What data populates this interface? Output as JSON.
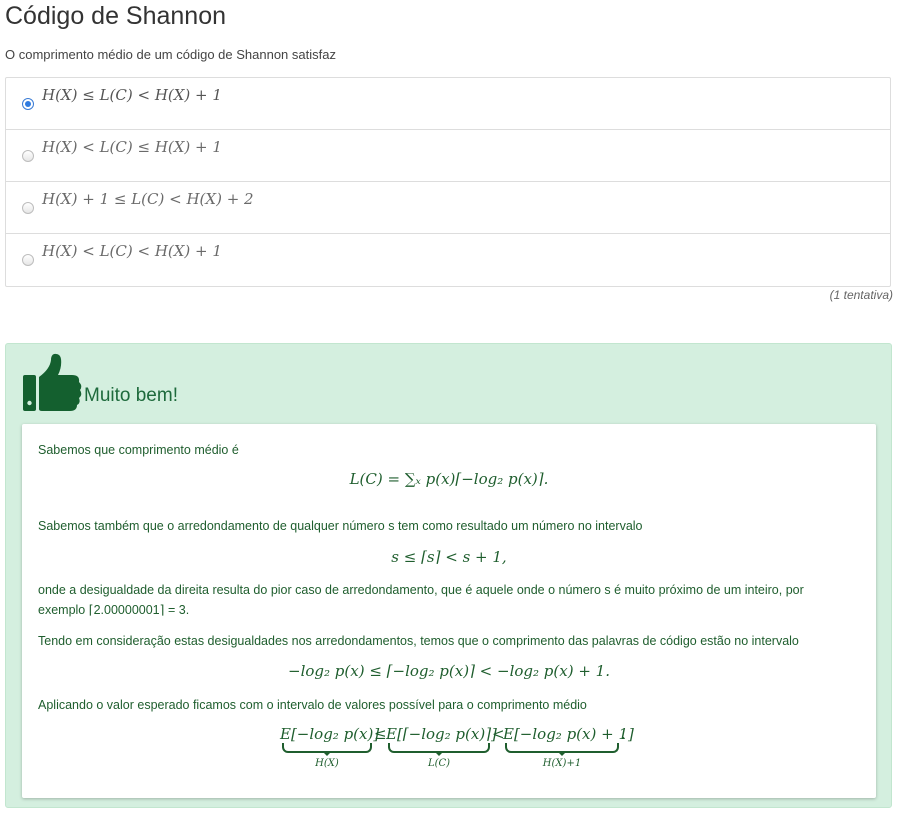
{
  "page": {
    "title": "Código de Shannon",
    "question": "O comprimento médio de um código de Shannon satisfaz"
  },
  "options": [
    {
      "label": "H(X) ≤ L(C) < H(X) + 1",
      "selected": true
    },
    {
      "label": "H(X) < L(C) ≤ H(X) + 1",
      "selected": false
    },
    {
      "label": "H(X) + 1 ≤ L(C) < H(X) + 2",
      "selected": false
    },
    {
      "label": "H(X) < L(C) < H(X) + 1",
      "selected": false
    }
  ],
  "attempts": "(1 tentativa)",
  "feedback": {
    "icon": "thumbs-up-icon",
    "title": "Muito bem!",
    "p1": "Sabemos que comprimento médio é",
    "eq1": "L(C) = ∑ₓ p(x)⌈−log₂ p(x)⌉.",
    "p2": "Sabemos também que o arredondamento de qualquer número s tem como resultado um número no intervalo",
    "eq2": "s ≤ ⌈s⌉ < s + 1,",
    "p3": "onde a desigualdade da direita resulta do pior caso de arredondamento, que é aquele onde o número s é muito próximo de um inteiro, por exemplo ⌈2.00000001⌉ = 3.",
    "p4": "Tendo em consideração estas desigualdades nos arredondamentos, temos que o comprimento das palavras de código estão no intervalo",
    "eq3": "−log₂ p(x) ≤ ⌈−log₂ p(x)⌉ < −log₂ p(x) + 1.",
    "p5": "Aplicando o valor esperado ficamos com o intervalo de valores possível para o comprimento médio",
    "eq4": {
      "term1": "E[−log₂ p(x)]",
      "term1_label": "H(X)",
      "rel1": "≤",
      "term2": "E[⌈−log₂ p(x)⌉]",
      "term2_label": "L(C)",
      "rel2": "<",
      "term3": "E[−log₂ p(x) + 1]",
      "term3_label": "H(X)+1",
      "end": "."
    }
  },
  "colors": {
    "feedback_bg": "#d4efdf",
    "feedback_text": "#1f5e2e",
    "radio_selected": "#2f7be0"
  }
}
